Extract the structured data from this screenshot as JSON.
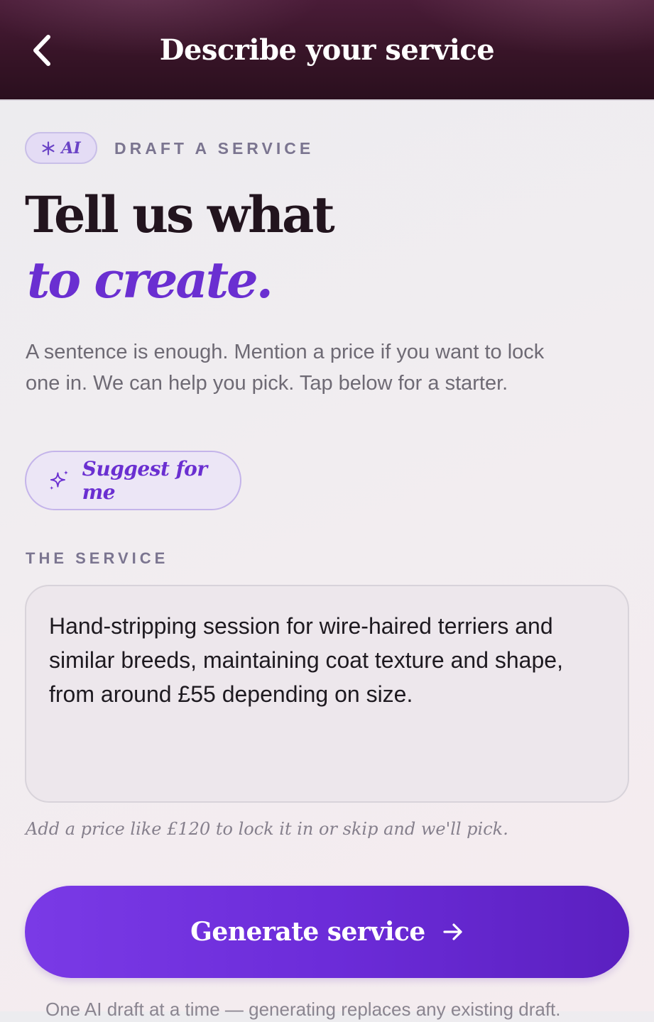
{
  "header": {
    "title": "Describe your service",
    "back_icon": "chevron-left-icon"
  },
  "badge": {
    "icon": "asterisk-icon",
    "label": "AI"
  },
  "eyebrow": "DRAFT A SERVICE",
  "title": {
    "line1": "Tell us what",
    "line2": "to create."
  },
  "description": "A sentence is enough. Mention a price if you want to lock one in. We can help you pick. Tap below for a starter.",
  "suggest_button": {
    "icon": "sparkles-icon",
    "label": "Suggest for me"
  },
  "service_section": {
    "label": "THE SERVICE",
    "value": "Hand-stripping session for wire-haired terriers and similar breeds, maintaining coat texture and shape, from around £55 depending on size.",
    "hint": "Add a price like £120 to lock it in or skip and we'll pick."
  },
  "generate_button": {
    "label": "Generate service",
    "icon": "arrow-right-icon"
  },
  "footnote": "One AI draft at a time — generating replaces any existing draft.",
  "colors": {
    "header_bg": "#371427",
    "accent": "#6a2fd1",
    "heading": "#22141e",
    "muted": "#7b7590"
  }
}
